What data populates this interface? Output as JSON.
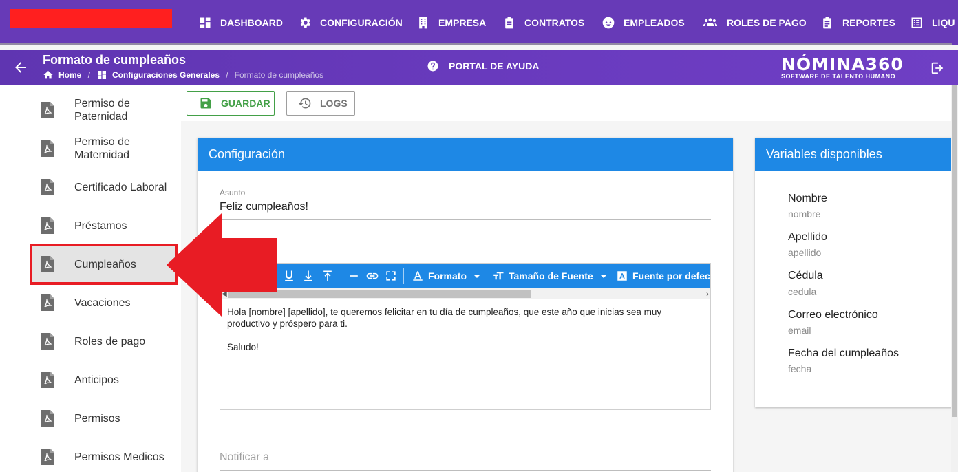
{
  "nav": {
    "items": [
      {
        "label": "DASHBOARD",
        "icon": "dashboard-icon"
      },
      {
        "label": "CONFIGURACIÓN",
        "icon": "gear-icon"
      },
      {
        "label": "EMPRESA",
        "icon": "building-icon"
      },
      {
        "label": "CONTRATOS",
        "icon": "clipboard-icon"
      },
      {
        "label": "EMPLEADOS",
        "icon": "face-icon"
      },
      {
        "label": "ROLES DE PAGO",
        "icon": "users-icon"
      },
      {
        "label": "REPORTES",
        "icon": "report-icon"
      },
      {
        "label": "LIQU",
        "icon": "list-icon"
      }
    ]
  },
  "header": {
    "title": "Formato de cumpleaños",
    "breadcrumb": {
      "home": "Home",
      "section": "Configuraciones Generales",
      "current": "Formato de cumpleaños"
    },
    "help": "PORTAL DE AYUDA",
    "brand": {
      "name": "NÓMINA360",
      "tagline": "SOFTWARE DE TALENTO HUMANO"
    }
  },
  "sidebar": {
    "items": [
      {
        "label": "Permiso de Paternidad"
      },
      {
        "label": "Permiso de Maternidad"
      },
      {
        "label": "Certificado Laboral"
      },
      {
        "label": "Préstamos"
      },
      {
        "label": "Cumpleaños",
        "active": true
      },
      {
        "label": "Vacaciones"
      },
      {
        "label": "Roles de pago"
      },
      {
        "label": "Anticipos"
      },
      {
        "label": "Permisos"
      },
      {
        "label": "Permisos Medicos"
      }
    ]
  },
  "toolbar": {
    "save_label": "GUARDAR",
    "logs_label": "LOGS"
  },
  "config": {
    "title": "Configuración",
    "subject_label": "Asunto",
    "subject_value": "Feliz cumpleaños!",
    "editor": {
      "toolbar": {
        "format": "Formato",
        "font_size": "Tamaño de Fuente",
        "font_default": "Fuente por defecto"
      },
      "body_line1": "Hola [nombre] [apellido], te queremos felicitar en tu día de cumpleaños, que este año que inicias sea muy productivo y próspero para ti.",
      "body_line2": "Saludo!"
    },
    "notify_label": "Notificar a"
  },
  "variables": {
    "title": "Variables disponibles",
    "items": [
      {
        "name": "Nombre",
        "key": "nombre"
      },
      {
        "name": "Apellido",
        "key": "apellido"
      },
      {
        "name": "Cédula",
        "key": "cedula"
      },
      {
        "name": "Correo electrónico",
        "key": "email"
      },
      {
        "name": "Fecha del cumpleaños",
        "key": "fecha"
      }
    ]
  },
  "colors": {
    "nav": "#673ab7",
    "accent": "#1e88e5",
    "save": "#43a047",
    "annotation": "#e81c24"
  }
}
